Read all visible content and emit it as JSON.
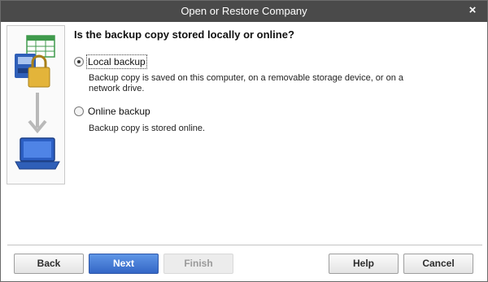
{
  "window": {
    "title": "Open or Restore Company",
    "close_glyph": "×"
  },
  "question": "Is the backup copy stored locally or online?",
  "options": [
    {
      "label": "Local backup",
      "description_line1": "Backup copy is saved on this computer, on a removable storage device, or on a",
      "description_line2": "network drive.",
      "selected": true
    },
    {
      "label": "Online backup",
      "description_line1": "Backup copy is stored online.",
      "selected": false
    }
  ],
  "buttons": {
    "back": "Back",
    "next": "Next",
    "finish": "Finish",
    "help": "Help",
    "cancel": "Cancel"
  },
  "side_panel": {
    "icons": [
      "spreadsheet-icon",
      "storage-drive-icon",
      "padlock-icon",
      "down-arrow-icon",
      "laptop-icon"
    ]
  },
  "colors": {
    "title_bar": "#4a4a4a",
    "primary_button": "#3d72d0",
    "icon_green": "#3f9a4c",
    "icon_blue": "#2f5fb8",
    "icon_gold": "#d9a625"
  }
}
